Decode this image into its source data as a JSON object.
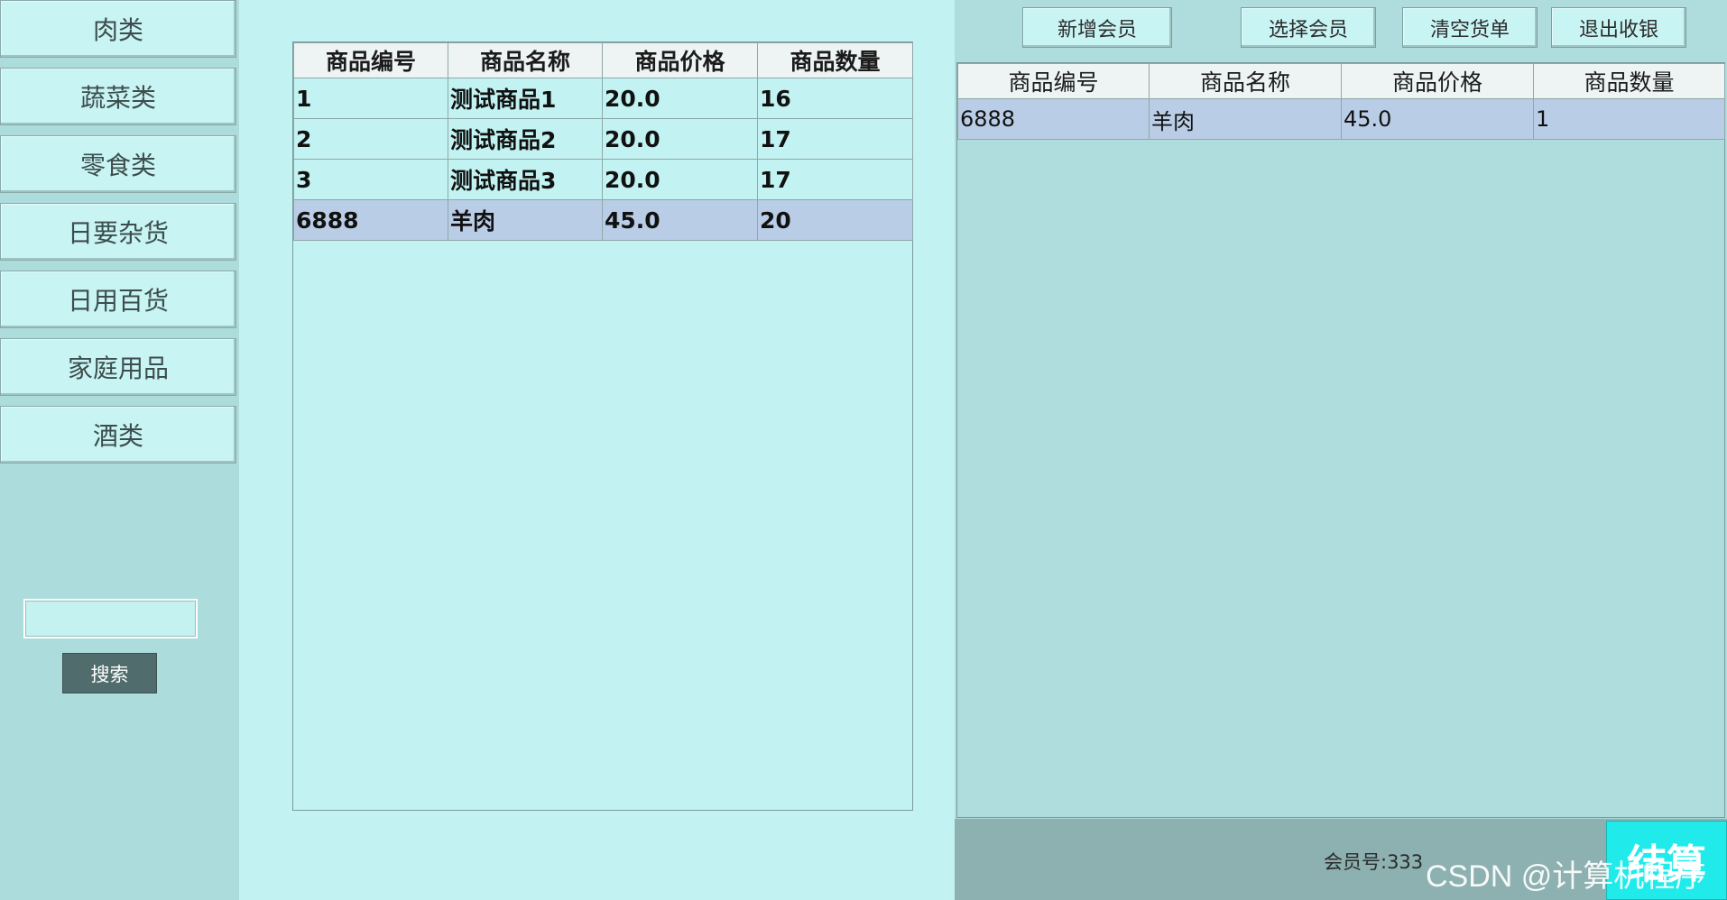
{
  "sidebar": {
    "categories": [
      "肉类",
      "蔬菜类",
      "零食类",
      "日要杂货",
      "日用百货",
      "家庭用品",
      "酒类"
    ],
    "search_value": "",
    "search_label": "搜索"
  },
  "products": {
    "columns": [
      "商品编号",
      "商品名称",
      "商品价格",
      "商品数量"
    ],
    "rows": [
      [
        "1",
        "测试商品1",
        "20.0",
        "16"
      ],
      [
        "2",
        "测试商品2",
        "20.0",
        "17"
      ],
      [
        "3",
        "测试商品3",
        "20.0",
        "17"
      ],
      [
        "6888",
        "羊肉",
        "45.0",
        "20"
      ]
    ],
    "selected_row": 3
  },
  "toolbar": {
    "add_member": "新增会员",
    "select_member": "选择会员",
    "clear_order": "清空货单",
    "exit_cashier": "退出收银"
  },
  "cart": {
    "columns": [
      "商品编号",
      "商品名称",
      "商品价格",
      "商品数量"
    ],
    "rows": [
      [
        "6888",
        "羊肉",
        "45.0",
        "1"
      ]
    ],
    "selected_row": 0
  },
  "footer": {
    "member_label": "会员号:333",
    "checkout_label": "结算"
  },
  "watermark": "CSDN @计算机程序",
  "colors": {
    "background": "#c2f3f2",
    "panel": "#afdcdc",
    "selected_row": "#bacde6",
    "checkout": "#20eaea"
  }
}
